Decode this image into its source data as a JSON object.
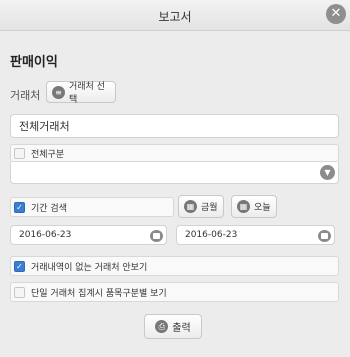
{
  "window": {
    "title": "보고서"
  },
  "section": {
    "title": "판매이익"
  },
  "client": {
    "label": "거래처",
    "select_button": "거래처 선택",
    "value": "전체거래처"
  },
  "category": {
    "label": "전체구분"
  },
  "period": {
    "label": "기간 검색",
    "checked": true,
    "month_button": "금월",
    "today_button": "오늘",
    "start_date": "2016-06-23",
    "end_date": "2016-06-23"
  },
  "options": [
    {
      "label": "거래내역이 없는 거래처 안보기",
      "checked": true
    },
    {
      "label": "단일 거래처 집계시 품목구분별 보기",
      "checked": false
    }
  ],
  "output_button": "출력",
  "icons": {
    "close": "close-icon",
    "list": "list-icon",
    "calendar": "calendar-icon",
    "chevron": "chevron-down-icon",
    "print": "print-icon"
  },
  "colors": {
    "checkbox_checked": "#3a7dd3"
  }
}
